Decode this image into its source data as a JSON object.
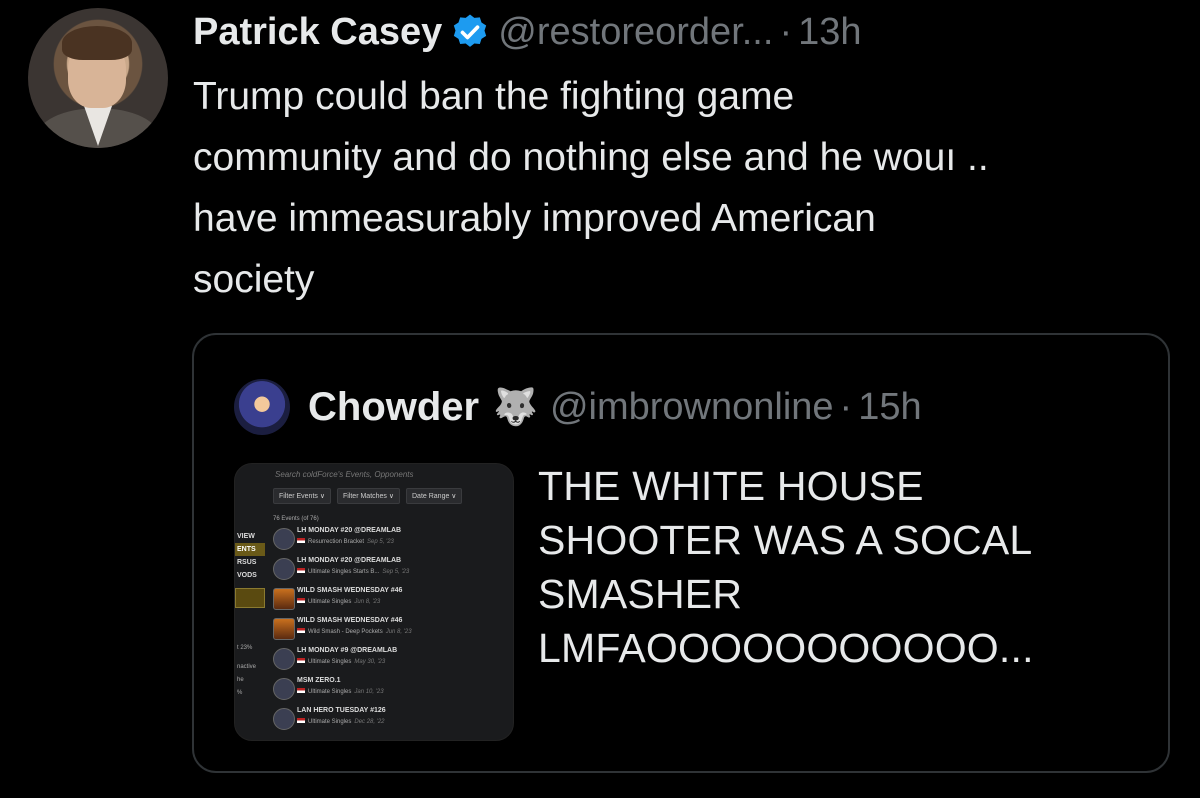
{
  "tweet": {
    "author_name": "Patrick Casey",
    "handle": "@restoreorder...",
    "separator": "·",
    "time": "13h",
    "verified_color": "#1d9bf0",
    "text_lines": [
      "Trump could ban the fighting game",
      "community and do nothing else and he wouı ..",
      "have immeasurably improved American",
      "society"
    ]
  },
  "quote": {
    "author_name": "Chowder",
    "emoji": "🐺",
    "handle": "@imbrownonline",
    "separator": "·",
    "time": "15h",
    "text_lines": [
      "THE WHITE HOUSE",
      "SHOOTER WAS A SOCAL",
      "SMASHER",
      "LMFAOOOOOOOOOOO..."
    ],
    "thumbnail": {
      "search_placeholder": "Search coldForce's Events, Opponents",
      "filters": [
        "Filter Events ∨",
        "Filter Matches ∨",
        "Date Range ∨"
      ],
      "count": "76 Events (of 76)",
      "left_nav": [
        "VIEW",
        "ENTS",
        "RSUS",
        "VODS"
      ],
      "left_nav_small": [
        "t 23%",
        "nactive",
        "he",
        "%"
      ],
      "events": [
        {
          "title": "LH MONDAY #20 @DREAMLAB",
          "sub": "Resurrection Bracket",
          "date": "Sep 5, '23",
          "icon": "lh"
        },
        {
          "title": "LH MONDAY #20 @DREAMLAB",
          "sub": "Ultimate Singles Starts B...",
          "date": "Sep 5, '23",
          "icon": "lh"
        },
        {
          "title": "WILD SMASH WEDNESDAY #46",
          "sub": "Ultimate Singles",
          "date": "Jun 8, '23",
          "icon": "fire"
        },
        {
          "title": "WILD SMASH WEDNESDAY #46",
          "sub": "Wild Smash - Deep Pockets",
          "date": "Jun 8, '23",
          "icon": "fire"
        },
        {
          "title": "LH MONDAY #9 @DREAMLAB",
          "sub": "Ultimate Singles",
          "date": "May 30, '23",
          "icon": "lh"
        },
        {
          "title": "MSM ZERO.1",
          "sub": "Ultimate Singles",
          "date": "Jan 10, '23",
          "icon": "lh"
        },
        {
          "title": "LAN HERO TUESDAY #126",
          "sub": "Ultimate Singles",
          "date": "Dec 28, '22",
          "icon": "lh"
        }
      ]
    }
  }
}
